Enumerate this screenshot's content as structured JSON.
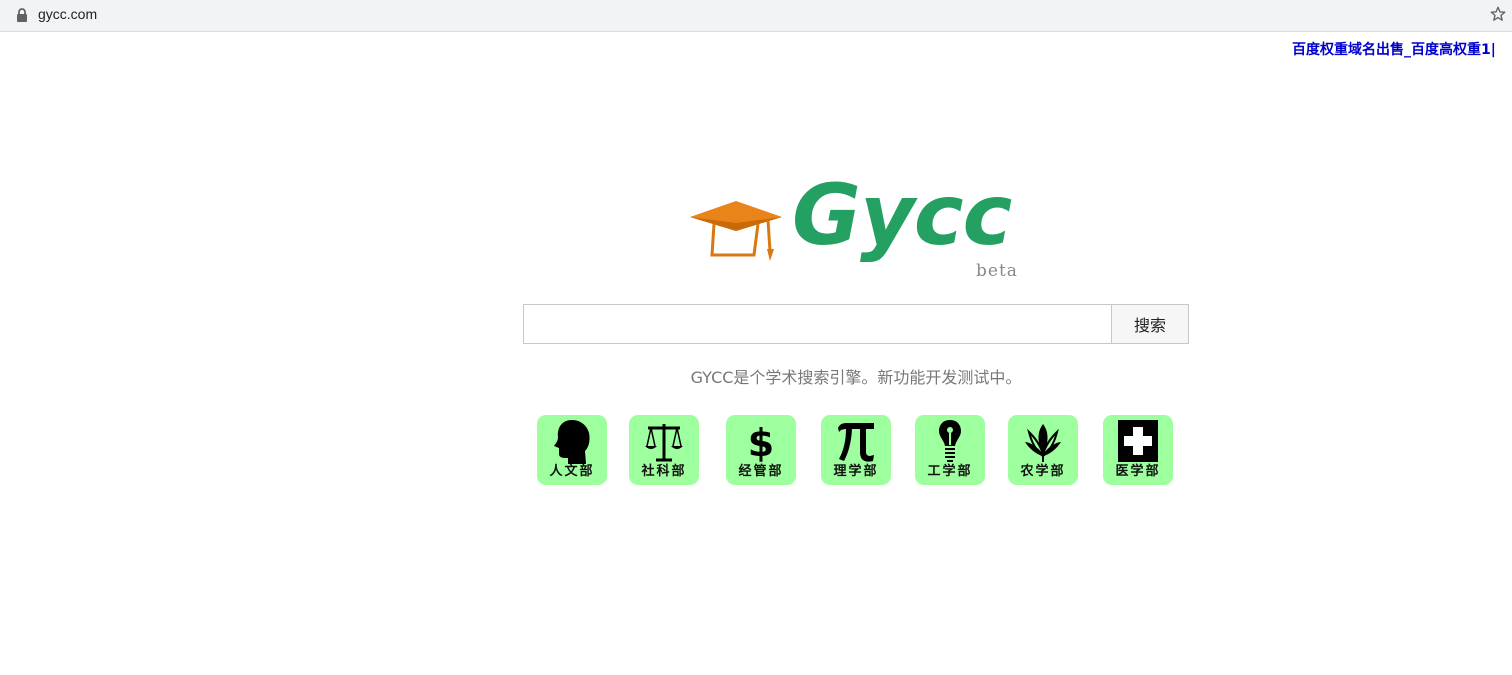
{
  "browser": {
    "url": "gycc.com",
    "lock_icon": "lock-icon",
    "bookmark_icon": "star-icon"
  },
  "ad": {
    "text": "百度权重域名出售_百度高权重1|"
  },
  "logo": {
    "wordmark": "Gycc",
    "badge": "beta",
    "icon": "graduation-cap-icon",
    "colors": {
      "wordmark": "#24a162",
      "cap": "#e07b10"
    }
  },
  "search": {
    "input_value": "",
    "button_label": "搜索"
  },
  "tagline": "GYCC是个学术搜索引擎。新功能开发测试中。",
  "departments": [
    {
      "label": "人文部",
      "icon": "head-profile-icon"
    },
    {
      "label": "社科部",
      "icon": "scales-icon"
    },
    {
      "label": "经管部",
      "icon": "dollar-icon"
    },
    {
      "label": "理学部",
      "icon": "pi-icon"
    },
    {
      "label": "工学部",
      "icon": "lightbulb-icon"
    },
    {
      "label": "农学部",
      "icon": "plant-icon"
    },
    {
      "label": "医学部",
      "icon": "medical-cross-icon"
    }
  ],
  "colors": {
    "tile_bg": "#9eff9e",
    "ad_link": "#0000cc"
  }
}
